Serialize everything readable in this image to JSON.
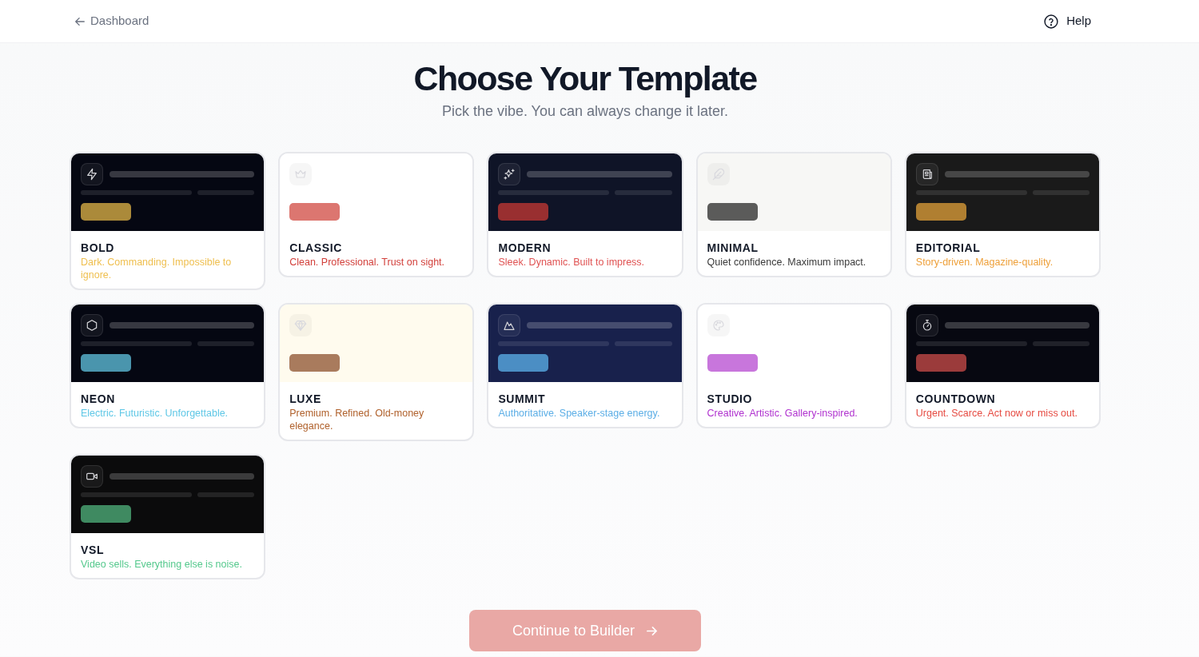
{
  "header": {
    "back_link": {
      "label": "Dashboard"
    },
    "help_link": {
      "label": "Help"
    }
  },
  "title": "Choose Your Template",
  "subtitle": "Pick the vibe. You can always change it later.",
  "templates": [
    {
      "name": "BOLD",
      "selected": false,
      "preview": {
        "kind": "dark",
        "color": "#050712"
      },
      "accent": {
        "color": "#ab8a3a"
      },
      "tagline": {
        "text": "Dark. Commanding. Impossible to ignore.",
        "color": "#efbf4f"
      }
    },
    {
      "name": "CLASSIC",
      "selected": false,
      "preview": {
        "kind": "light",
        "color": "#ffffff"
      },
      "accent": {
        "color": "#dc7670"
      },
      "tagline": {
        "text": "Clean. Professional. Trust on sight.",
        "color": "#d23f3a"
      }
    },
    {
      "name": "MODERN",
      "selected": false,
      "preview": {
        "kind": "dark",
        "color": "#0f1427"
      },
      "accent": {
        "color": "#992f30"
      },
      "tagline": {
        "text": "Sleek. Dynamic. Built to impress.",
        "color": "#e05353"
      }
    },
    {
      "name": "MINIMAL",
      "selected": false,
      "preview": {
        "kind": "light",
        "color": "#f7f7f5"
      },
      "accent": {
        "color": "#5b5b5a"
      },
      "tagline": {
        "text": "Quiet confidence. Maximum impact.",
        "color": "#3a3a3a"
      }
    },
    {
      "name": "EDITORIAL",
      "selected": false,
      "preview": {
        "kind": "dark",
        "color": "#1a1a1a"
      },
      "accent": {
        "color": "#b07f31"
      },
      "tagline": {
        "text": "Story-driven. Magazine-quality.",
        "color": "#eea03a"
      }
    },
    {
      "name": "NEON",
      "selected": false,
      "preview": {
        "kind": "dark",
        "color": "#050712"
      },
      "accent": {
        "color": "#4a95ad"
      },
      "tagline": {
        "text": "Electric. Futuristic. Unforgettable.",
        "color": "#5ec7e6"
      }
    },
    {
      "name": "LUXE",
      "selected": false,
      "preview": {
        "kind": "light",
        "color": "#fffbee"
      },
      "accent": {
        "color": "#a97b5d"
      },
      "tagline": {
        "text": "Premium. Refined. Old-money elegance.",
        "color": "#b0612c"
      }
    },
    {
      "name": "SUMMIT",
      "selected": false,
      "preview": {
        "kind": "dark",
        "color": "#18214c"
      },
      "accent": {
        "color": "#4b8ec4"
      },
      "tagline": {
        "text": "Authoritative. Speaker-stage energy.",
        "color": "#5caee6"
      }
    },
    {
      "name": "STUDIO",
      "selected": false,
      "preview": {
        "kind": "light",
        "color": "#ffffff"
      },
      "accent": {
        "color": "#c876dc"
      },
      "tagline": {
        "text": "Creative. Artistic. Gallery-inspired.",
        "color": "#b032cf"
      }
    },
    {
      "name": "COUNTDOWN",
      "selected": false,
      "preview": {
        "kind": "dark",
        "color": "#070811"
      },
      "accent": {
        "color": "#9b3b3b"
      },
      "tagline": {
        "text": "Urgent. Scarce. Act now or miss out.",
        "color": "#e64b42"
      }
    },
    {
      "name": "VSL",
      "selected": false,
      "preview": {
        "kind": "dark",
        "color": "#0b0b0c"
      },
      "accent": {
        "color": "#3f8a61"
      },
      "tagline": {
        "text": "Video sells. Everything else is noise.",
        "color": "#55c98d"
      }
    }
  ],
  "continue_button": {
    "label": "Continue to Builder",
    "disabled": true
  }
}
